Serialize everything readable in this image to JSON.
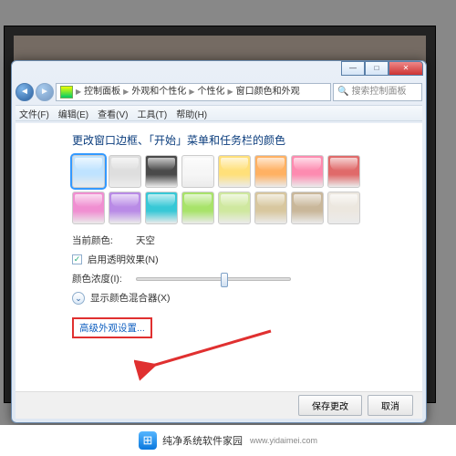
{
  "window": {
    "breadcrumb": {
      "icon": "monitor-icon",
      "p1": "控制面板",
      "p2": "外观和个性化",
      "p3": "个性化",
      "p4": "窗口颜色和外观"
    },
    "search_placeholder": "搜索控制面板",
    "buttons": {
      "min": "—",
      "max": "□",
      "close": "✕"
    }
  },
  "menubar": {
    "file": "文件(F)",
    "edit": "编辑(E)",
    "view": "查看(V)",
    "tools": "工具(T)",
    "help": "帮助(H)"
  },
  "page": {
    "heading": "更改窗口边框、「开始」菜单和任务栏的颜色",
    "swatches": [
      "#bfe3ff",
      "#dedede",
      "#4a4a4a",
      "#f6f6f6",
      "#ffe07a",
      "#ffb163",
      "#fd8bb0",
      "#e06a6a",
      "#f08fd1",
      "#b98be6",
      "#38c8d6",
      "#a8e36a",
      "#cfe89f",
      "#d8c79f",
      "#c9b79a",
      "#ece7df"
    ],
    "selected_swatch_index": 0,
    "current_label": "当前颜色:",
    "current_value": "天空",
    "transparency_label": "启用透明效果(N)",
    "transparency_checked": true,
    "intensity_label": "颜色浓度(I):",
    "mixer_label": "显示颜色混合器(X)",
    "advanced_link": "高级外观设置..."
  },
  "footer": {
    "save": "保存更改",
    "cancel": "取消"
  },
  "watermark": {
    "name": "纯净系统软件家园",
    "url": "www.yidaimei.com"
  }
}
